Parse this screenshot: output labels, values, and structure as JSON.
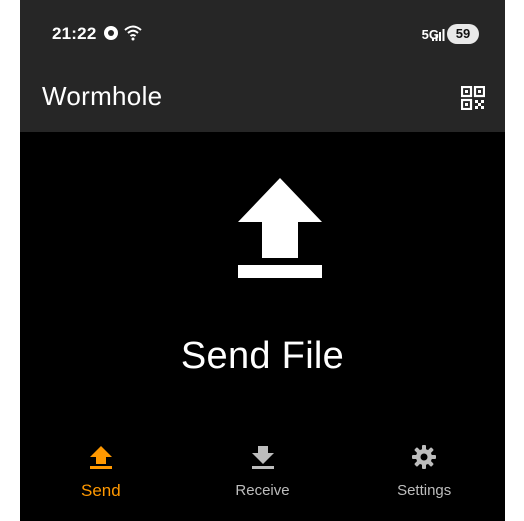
{
  "status_bar": {
    "time": "21:22",
    "network": "5G",
    "battery": "59"
  },
  "app_bar": {
    "title": "Wormhole",
    "qr_icon": "qr-code-icon"
  },
  "main": {
    "send_file_label": "Send File",
    "icon": "upload-icon"
  },
  "bottom_nav": {
    "items": [
      {
        "label": "Send",
        "icon": "upload-icon",
        "active": true
      },
      {
        "label": "Receive",
        "icon": "download-icon",
        "active": false
      },
      {
        "label": "Settings",
        "icon": "gear-icon",
        "active": false
      }
    ]
  },
  "colors": {
    "accent": "#ff9800",
    "app_bar": "#262626",
    "background": "#000000",
    "inactive": "#bdbdbd"
  }
}
